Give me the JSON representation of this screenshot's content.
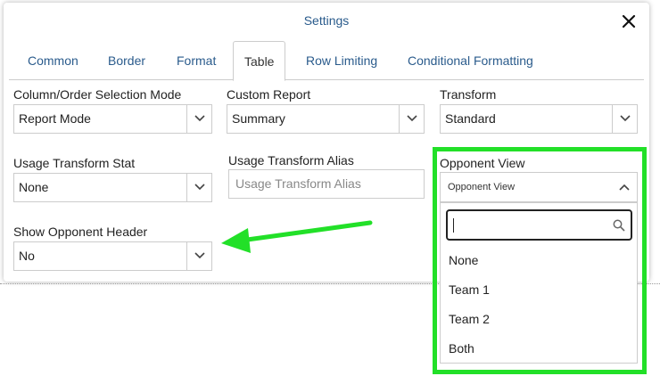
{
  "dialog": {
    "title": "Settings"
  },
  "tabs": [
    {
      "label": "Common"
    },
    {
      "label": "Border"
    },
    {
      "label": "Format"
    },
    {
      "label": "Table",
      "active": true
    },
    {
      "label": "Row Limiting"
    },
    {
      "label": "Conditional Formatting"
    }
  ],
  "fields": {
    "column_order_mode": {
      "label": "Column/Order Selection Mode",
      "value": "Report Mode"
    },
    "custom_report": {
      "label": "Custom Report",
      "value": "Summary"
    },
    "transform": {
      "label": "Transform",
      "value": "Standard"
    },
    "usage_transform_stat": {
      "label": "Usage Transform Stat",
      "value": "None"
    },
    "usage_transform_alias": {
      "label": "Usage Transform Alias",
      "placeholder": "Usage Transform Alias"
    },
    "opponent_view": {
      "label": "Opponent View",
      "value": "Opponent View"
    },
    "show_opponent_header": {
      "label": "Show Opponent Header",
      "value": "No"
    }
  },
  "opponent_dropdown": {
    "search_value": "",
    "options": [
      "None",
      "Team 1",
      "Team 2",
      "Both"
    ]
  },
  "annotation": {
    "highlight_color": "#22e028",
    "arrow_color": "#22e028"
  },
  "colors": {
    "link": "#2a5b8c",
    "border": "#cccccc"
  }
}
